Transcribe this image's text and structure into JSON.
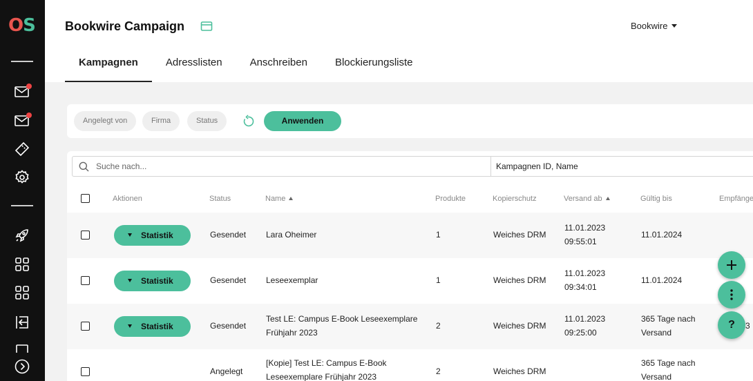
{
  "sidebar": {
    "logo_o": "O",
    "logo_s": "S"
  },
  "header": {
    "title": "Bookwire Campaign",
    "org": "Bookwire"
  },
  "tabs": [
    {
      "label": "Kampagnen"
    },
    {
      "label": "Adresslisten"
    },
    {
      "label": "Anschreiben"
    },
    {
      "label": "Blockierungsliste"
    }
  ],
  "filters": {
    "chips": [
      "Angelegt von",
      "Firma",
      "Status"
    ],
    "apply_label": "Anwenden"
  },
  "search": {
    "placeholder": "Suche nach...",
    "scope": "Kampagnen ID, Name"
  },
  "table": {
    "columns": [
      "Aktionen",
      "Status",
      "Name",
      "Produkte",
      "Kopierschutz",
      "Versand ab",
      "Gültig bis",
      "Empfänger"
    ],
    "rows": [
      {
        "action": "Statistik",
        "status": "Gesendet",
        "name_1": "Lara Oheimer",
        "name_2": "",
        "products": "1",
        "drm": "Weiches DRM",
        "sent_date": "11.01.2023",
        "sent_time": "09:55:01",
        "valid_1": "11.01.2024",
        "valid_2": "",
        "recipients": ""
      },
      {
        "action": "Statistik",
        "status": "Gesendet",
        "name_1": "Leseexemplar",
        "name_2": "",
        "products": "1",
        "drm": "Weiches DRM",
        "sent_date": "11.01.2023",
        "sent_time": "09:34:01",
        "valid_1": "11.01.2024",
        "valid_2": "",
        "recipients": ""
      },
      {
        "action": "Statistik",
        "status": "Gesendet",
        "name_1": "Test LE: Campus E-Book Leseexemplare",
        "name_2": "Frühjahr 2023",
        "products": "2",
        "drm": "Weiches DRM",
        "sent_date": "11.01.2023",
        "sent_time": "09:25:00",
        "valid_1": "365 Tage nach",
        "valid_2": "Versand",
        "recipients": "3"
      },
      {
        "action": "",
        "status": "Angelegt",
        "name_1": "[Kopie] Test LE: Campus E-Book",
        "name_2": "Leseexemplare Frühjahr 2023",
        "products": "2",
        "drm": "Weiches DRM",
        "sent_date": "",
        "sent_time": "",
        "valid_1": "365 Tage nach",
        "valid_2": "Versand",
        "recipients": ""
      }
    ]
  },
  "fab": {
    "help_label": "?"
  },
  "colors": {
    "accent": "#4cbf9c",
    "sidebar": "#111111",
    "logo_o": "#e8554e",
    "notification": "#ef4444"
  }
}
